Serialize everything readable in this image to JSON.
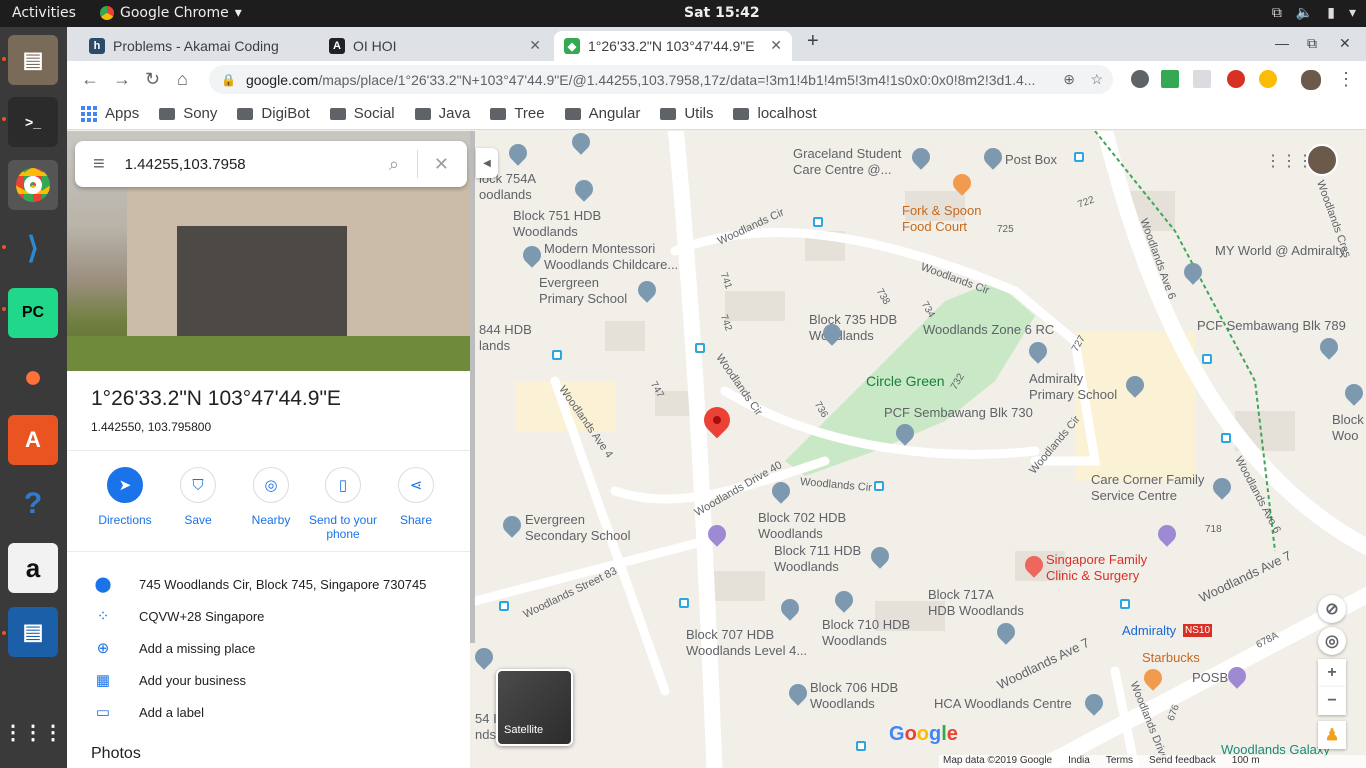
{
  "system": {
    "activities": "Activities",
    "app_name": "Google Chrome",
    "clock": "Sat 15:42"
  },
  "tabs": [
    {
      "label": "Problems - Akamai Coding",
      "favicon_color": "#2d4a6b"
    },
    {
      "label": "OI HOI",
      "favicon_color": "#202124"
    },
    {
      "label": "1°26'33.2\"N 103°47'44.9\"E",
      "favicon_color": "#34a853"
    }
  ],
  "address_bar": {
    "host": "google.com",
    "path": "/maps/place/1°26'33.2\"N+103°47'44.9\"E/@1.44255,103.7958,17z/data=!3m1!4b1!4m5!3m4!1s0x0:0x0!8m2!3d1.4..."
  },
  "bookmarks": [
    "Apps",
    "Sony",
    "DigiBot",
    "Social",
    "Java",
    "Tree",
    "Angular",
    "Utils",
    "localhost"
  ],
  "search": {
    "query": "1.44255,103.7958"
  },
  "place": {
    "title": "1°26'33.2\"N 103°47'44.9\"E",
    "decimal": "1.442550, 103.795800"
  },
  "actions": [
    {
      "label": "Directions"
    },
    {
      "label": "Save"
    },
    {
      "label": "Nearby"
    },
    {
      "label": "Send to your phone"
    },
    {
      "label": "Share"
    }
  ],
  "info": {
    "address": "745 Woodlands Cir, Block 745, Singapore 730745",
    "plus_code": "CQVW+28 Singapore",
    "add_missing": "Add a missing place",
    "add_business": "Add your business",
    "add_label": "Add a label"
  },
  "photos_heading": "Photos",
  "map": {
    "satellite_label": "Satellite",
    "logo": "Google",
    "footer": {
      "data": "Map data ©2019 Google",
      "country": "India",
      "terms": "Terms",
      "feedback": "Send feedback",
      "scale": "100 m"
    },
    "labels": {
      "graceland": "Graceland Student\nCare Centre @...",
      "post_box": "Post Box",
      "fork_spoon": "Fork & Spoon\nFood Court",
      "my_world": "MY World @ Admiralty",
      "blk754": "lock 754A\noodlands",
      "blk751": "Block 751 HDB\nWoodlands",
      "montessori": "Modern Montessori\nWoodlands Childcare...",
      "evergreen_pri": "Evergreen\nPrimary School",
      "blk844": "844 HDB\nlands",
      "blk735": "Block 735 HDB\nWoodlands",
      "zone6": "Woodlands Zone 6 RC",
      "pcf789": "PCF Sembawang Blk 789",
      "circle_green": "Circle Green",
      "admiralty_pri": "Admiralty\nPrimary School",
      "pcf730": "PCF Sembawang Blk 730",
      "block_r": "Block\nWoo",
      "care_corner": "Care Corner Family\nService Centre",
      "evergreen_sec": "Evergreen\nSecondary School",
      "blk702": "Block 702 HDB\nWoodlands",
      "blk711": "Block 711 HDB\nWoodlands",
      "sg_family": "Singapore Family\nClinic & Surgery",
      "blk717a": "Block 717A\nHDB Woodlands",
      "blk710": "Block 710 HDB\nWoodlands",
      "blk707": "Block 707 HDB\nWoodlands Level 4...",
      "admiralty_mrt": "Admiralty",
      "ns10": "NS10",
      "starbucks": "Starbucks",
      "posb": "POSB",
      "blk706": "Block 706 HDB\nWoodlands",
      "hca": "HCA Woodlands Centre",
      "galaxy": "Woodlands Galaxy",
      "blk54": "54 I\nnds",
      "cir1": "Woodlands Cir",
      "cir2": "Woodlands Cir",
      "cir3": "Woodlands Cir",
      "cir4": "Woodlands Cir",
      "cir5": "Woodlands Cir",
      "ave4": "Woodlands Ave 4",
      "ave6": "Woodlands Ave 6",
      "ave6b": "Woodlands Ave 6",
      "ave7": "Woodlands Ave 7",
      "ave7b": "Woodlands Ave 7",
      "drive40": "Woodlands Drive 40",
      "st83": "Woodlands Street 83",
      "drive_b": "Woodlands Drive",
      "cres": "Woodlands Cres",
      "n722": "722",
      "n725": "725",
      "n741": "741",
      "n738": "738",
      "n734": "734",
      "n742": "742",
      "n727": "727",
      "n747": "747",
      "n732": "732",
      "n736": "736",
      "n718": "718",
      "n678a": "678A",
      "n676": "676"
    }
  }
}
